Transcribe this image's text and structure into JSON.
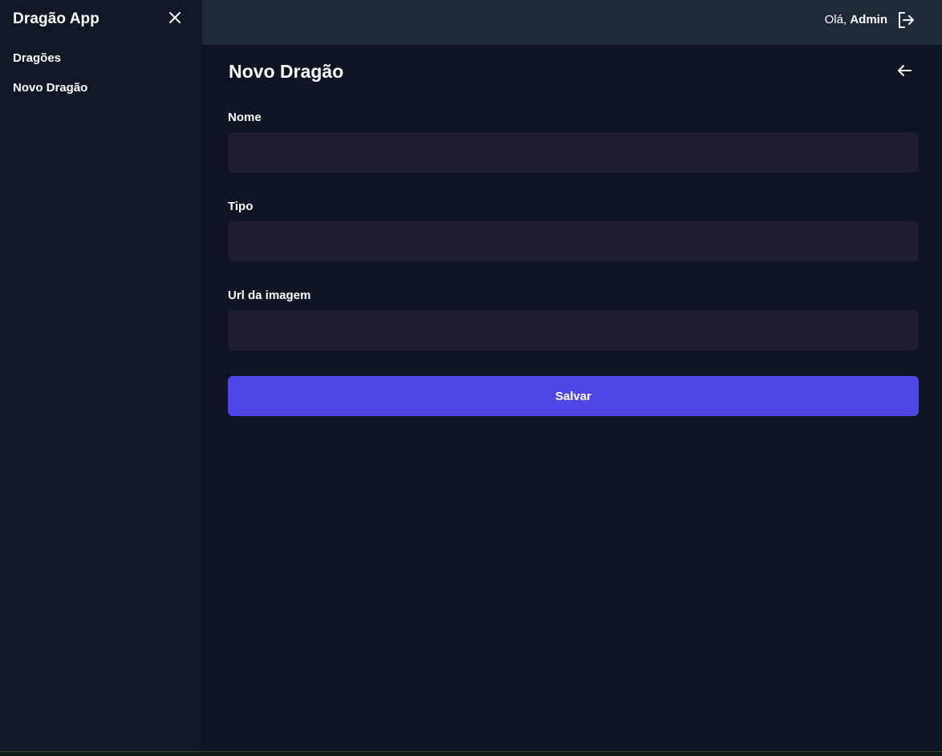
{
  "sidebar": {
    "title": "Dragão App",
    "close_icon": "close-icon",
    "items": [
      {
        "label": "Dragões"
      },
      {
        "label": "Novo Dragão"
      }
    ]
  },
  "header": {
    "greeting_prefix": "Olá, ",
    "user_name": "Admin",
    "logout_icon": "logout-icon"
  },
  "main": {
    "title": "Novo Dragão",
    "back_icon": "arrow-left-icon",
    "fields": [
      {
        "label": "Nome",
        "value": "",
        "placeholder": ""
      },
      {
        "label": "Tipo",
        "value": "",
        "placeholder": ""
      },
      {
        "label": "Url da imagem",
        "value": "",
        "placeholder": ""
      }
    ],
    "save_label": "Salvar"
  },
  "colors": {
    "background": "#0f1524",
    "sidebar": "#111827",
    "header": "#1f2937",
    "input": "#1f1f2f",
    "accent": "#4f46e5"
  }
}
